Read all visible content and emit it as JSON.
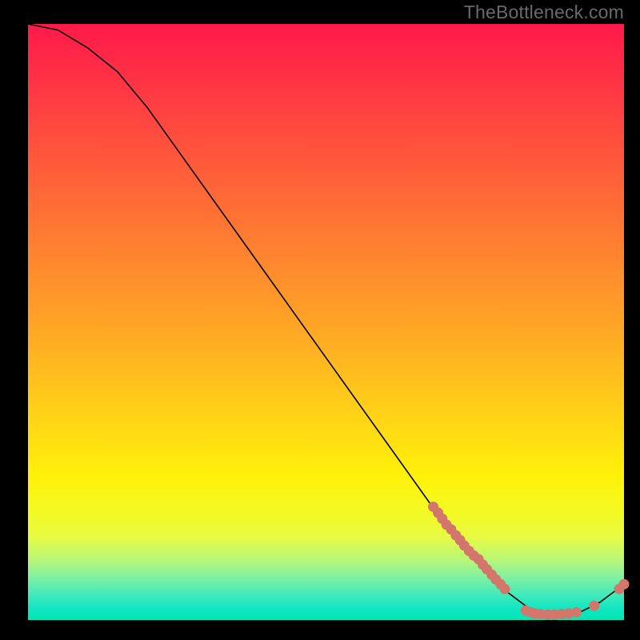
{
  "watermark": "TheBottleneck.com",
  "chart_data": {
    "type": "line",
    "title": "",
    "xlabel": "",
    "ylabel": "",
    "xlim": [
      0,
      100
    ],
    "ylim": [
      0,
      100
    ],
    "curve": [
      {
        "x": 0,
        "y": 100
      },
      {
        "x": 5,
        "y": 99
      },
      {
        "x": 10,
        "y": 96
      },
      {
        "x": 15,
        "y": 92
      },
      {
        "x": 20,
        "y": 86
      },
      {
        "x": 25,
        "y": 79
      },
      {
        "x": 30,
        "y": 72
      },
      {
        "x": 35,
        "y": 65
      },
      {
        "x": 40,
        "y": 58
      },
      {
        "x": 45,
        "y": 51
      },
      {
        "x": 50,
        "y": 44
      },
      {
        "x": 55,
        "y": 37
      },
      {
        "x": 60,
        "y": 30
      },
      {
        "x": 65,
        "y": 23
      },
      {
        "x": 70,
        "y": 16
      },
      {
        "x": 75,
        "y": 10
      },
      {
        "x": 80,
        "y": 5
      },
      {
        "x": 84,
        "y": 2
      },
      {
        "x": 87,
        "y": 1
      },
      {
        "x": 90,
        "y": 1
      },
      {
        "x": 93,
        "y": 1.5
      },
      {
        "x": 96,
        "y": 3
      },
      {
        "x": 98,
        "y": 4.5
      },
      {
        "x": 100,
        "y": 6
      }
    ],
    "dot_clusters": [
      {
        "x": 68.0,
        "y": 19.0
      },
      {
        "x": 68.8,
        "y": 18.0
      },
      {
        "x": 69.5,
        "y": 17.0
      },
      {
        "x": 70.2,
        "y": 16.0
      },
      {
        "x": 71.0,
        "y": 15.2
      },
      {
        "x": 71.8,
        "y": 14.2
      },
      {
        "x": 72.5,
        "y": 13.4
      },
      {
        "x": 73.2,
        "y": 12.5
      },
      {
        "x": 74.0,
        "y": 11.6
      },
      {
        "x": 74.8,
        "y": 10.8
      },
      {
        "x": 75.6,
        "y": 10.2
      },
      {
        "x": 76.3,
        "y": 9.3
      },
      {
        "x": 77.0,
        "y": 8.5
      },
      {
        "x": 77.8,
        "y": 7.6
      },
      {
        "x": 78.5,
        "y": 6.8
      },
      {
        "x": 79.3,
        "y": 6.0
      },
      {
        "x": 80.0,
        "y": 5.2
      },
      {
        "x": 83.5,
        "y": 1.6
      },
      {
        "x": 84.3,
        "y": 1.3
      },
      {
        "x": 85.0,
        "y": 1.1
      },
      {
        "x": 86.0,
        "y": 1.0
      },
      {
        "x": 87.2,
        "y": 0.9
      },
      {
        "x": 88.3,
        "y": 0.9
      },
      {
        "x": 89.5,
        "y": 1.0
      },
      {
        "x": 90.7,
        "y": 1.1
      },
      {
        "x": 92.0,
        "y": 1.3
      },
      {
        "x": 95.0,
        "y": 2.4
      },
      {
        "x": 99.2,
        "y": 5.2
      },
      {
        "x": 100.0,
        "y": 6.0
      }
    ],
    "colors": {
      "gradient_top": "#ff1a4a",
      "gradient_bottom": "#00e6b5",
      "curve": "#000000",
      "dots": "#d3766c",
      "background": "#000000",
      "watermark": "#6a6a6a"
    }
  }
}
